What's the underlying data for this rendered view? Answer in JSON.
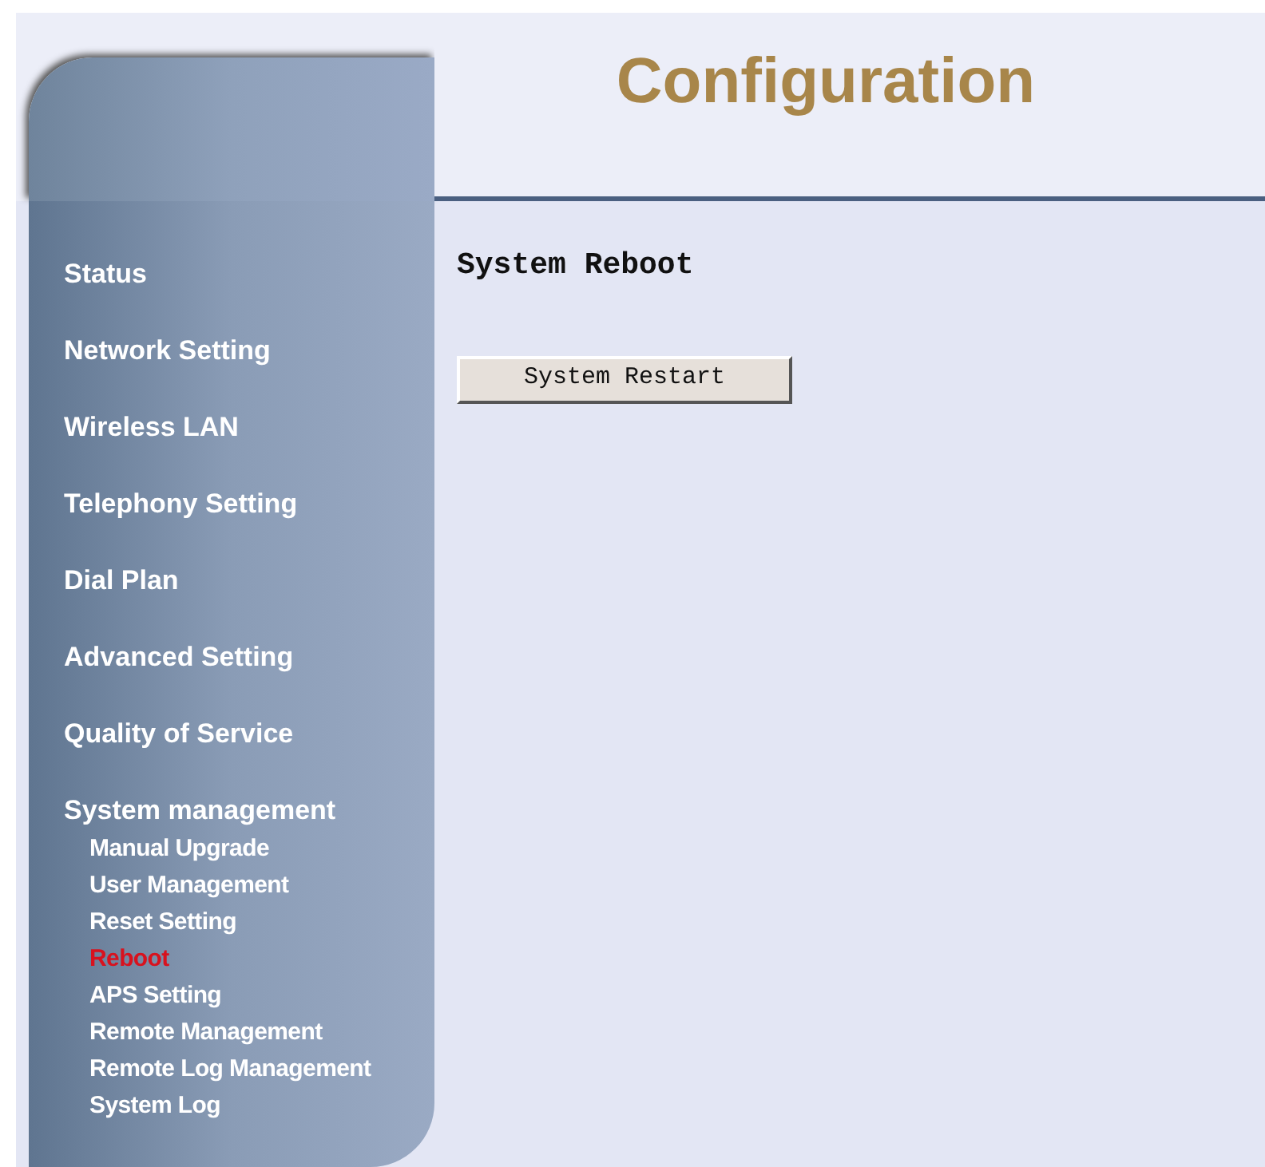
{
  "header": {
    "title": "Configuration"
  },
  "sidebar": {
    "items": [
      {
        "label": "Status",
        "selected": false
      },
      {
        "label": "Network Setting",
        "selected": false
      },
      {
        "label": "Wireless LAN",
        "selected": false
      },
      {
        "label": "Telephony Setting",
        "selected": false
      },
      {
        "label": "Dial Plan",
        "selected": false
      },
      {
        "label": "Advanced Setting",
        "selected": false
      },
      {
        "label": "Quality of Service",
        "selected": false
      },
      {
        "label": "System management",
        "selected": false,
        "children": [
          {
            "label": "Manual Upgrade",
            "selected": false
          },
          {
            "label": "User Management",
            "selected": false
          },
          {
            "label": "Reset Setting",
            "selected": false
          },
          {
            "label": "Reboot",
            "selected": true
          },
          {
            "label": "APS Setting",
            "selected": false
          },
          {
            "label": "Remote Management",
            "selected": false
          },
          {
            "label": "Remote Log Management",
            "selected": false
          },
          {
            "label": "System Log",
            "selected": false
          }
        ]
      }
    ]
  },
  "content": {
    "heading": "System Reboot",
    "button": "System Restart"
  }
}
